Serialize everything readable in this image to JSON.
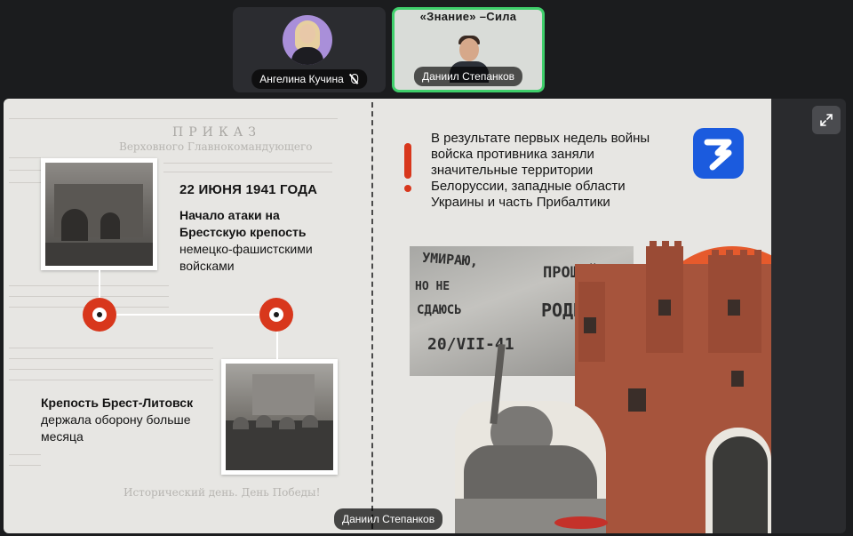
{
  "participants": [
    {
      "name": "Ангелина Кучина",
      "muted": true
    },
    {
      "name": "Даниил Степанков",
      "banner": "«Знание» –Сила",
      "active": true
    }
  ],
  "active_speaker": "Даниил Степанков",
  "slide": {
    "left": {
      "date_title": "22 ИЮНЯ 1941 ГОДА",
      "event_1_bold": "Начало атаки на Брестскую крепость",
      "event_1_rest": "немецко-фашистскими войсками",
      "event_2_bold": "Крепость Брест-Литовск",
      "event_2_rest": "держала оборону больше месяца",
      "newspaper_header": "ПРИКАЗ",
      "newspaper_sub": "Верховного Главнокомандующего",
      "newspaper_footer": "Исторический день. День Победы!"
    },
    "right": {
      "info": "В результате первых недель войны войска противника заняли значительные территории Белоруссии, западные области Украины и часть Прибалтики",
      "wall_lines": [
        "УМИРАЮ,",
        "НО НЕ",
        "СДАЮСЬ",
        "ПРОЩАЙ",
        "РОДИНА",
        "20/VII-41"
      ]
    }
  },
  "colors": {
    "accent_red": "#d8371c",
    "logo_blue": "#1b5bde",
    "active_border": "#3fcf6b"
  },
  "icons": {
    "mic": "mic-off-icon",
    "expand": "expand-icon",
    "logo": "znanie-logo-icon"
  }
}
